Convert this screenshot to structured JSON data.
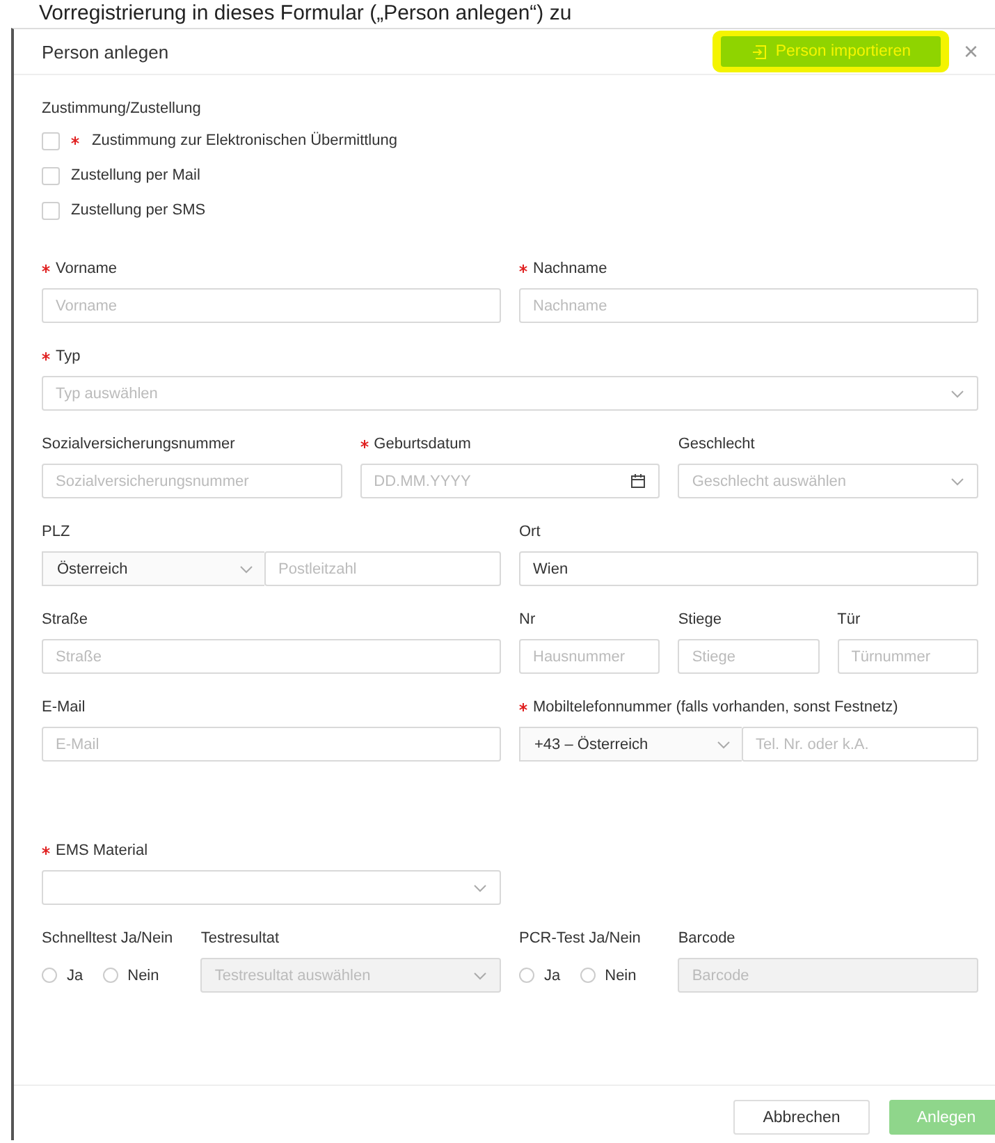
{
  "background_text": "Vorregistrierung in dieses Formular („Person anlegen“) zu",
  "dialog": {
    "title": "Person anlegen",
    "import_button": "Person importieren",
    "import_highlighted": true,
    "close": "×"
  },
  "consent": {
    "heading": "Zustimmung/Zustellung",
    "items": [
      {
        "label": "Zustimmung zur Elektronischen Übermittlung",
        "required": true,
        "checked": false
      },
      {
        "label": "Zustellung per Mail",
        "required": false,
        "checked": false
      },
      {
        "label": "Zustellung per SMS",
        "required": false,
        "checked": false
      }
    ]
  },
  "person_rows": [
    {
      "kind": "halves",
      "fields": [
        {
          "kind": "text",
          "label": "Vorname",
          "required": true,
          "placeholder": "Vorname"
        },
        {
          "kind": "text",
          "label": "Nachname",
          "required": true,
          "placeholder": "Nachname"
        }
      ]
    },
    {
      "kind": "full",
      "fields": [
        {
          "kind": "select",
          "label": "Typ",
          "required": true,
          "placeholder": "Typ auswählen",
          "disabled": false
        }
      ]
    },
    {
      "kind": "thirds",
      "fields": [
        {
          "kind": "text",
          "label": "Sozialversicherungsnummer",
          "required": false,
          "placeholder": "Sozialversicherungsnummer"
        },
        {
          "kind": "date",
          "label": "Geburtsdatum",
          "required": true,
          "placeholder": "DD.MM.YYYY"
        },
        {
          "kind": "select",
          "label": "Geschlecht",
          "required": false,
          "placeholder": "Geschlecht auswählen",
          "disabled": false
        }
      ]
    },
    {
      "kind": "halves",
      "fields": [
        {
          "kind": "prefixed",
          "label": "PLZ",
          "required": false,
          "prefix": "Österreich",
          "placeholder": "Postleitzahl"
        },
        {
          "kind": "text",
          "label": "Ort",
          "required": false,
          "value": "Wien"
        }
      ]
    },
    {
      "kind": "street",
      "fields": [
        {
          "kind": "text",
          "label": "Straße",
          "required": false,
          "placeholder": "Straße"
        },
        {
          "kind": "text",
          "label": "Nr",
          "required": false,
          "placeholder": "Hausnummer"
        },
        {
          "kind": "text",
          "label": "Stiege",
          "required": false,
          "placeholder": "Stiege"
        },
        {
          "kind": "text",
          "label": "Tür",
          "required": false,
          "placeholder": "Türnummer"
        }
      ]
    },
    {
      "kind": "halves",
      "fields": [
        {
          "kind": "text",
          "label": "E-Mail",
          "required": false,
          "placeholder": "E-Mail"
        },
        {
          "kind": "prefixed",
          "label": "Mobiltelefonnummer (falls vorhanden, sonst Festnetz)",
          "required": true,
          "prefix": "+43 – Österreich",
          "placeholder": "Tel. Nr. oder k.A."
        }
      ]
    }
  ],
  "test_rows": [
    {
      "kind": "half",
      "fields": [
        {
          "kind": "select",
          "label": "EMS Material",
          "required": true,
          "disabled": false
        }
      ]
    },
    {
      "kind": "tests",
      "fields": [
        {
          "kind": "radio",
          "label": "Schnelltest Ja/Nein",
          "required": false,
          "options": [
            {
              "label": "Ja",
              "selected": false
            },
            {
              "label": "Nein",
              "selected": false
            }
          ]
        },
        {
          "kind": "select",
          "label": "Testresultat",
          "required": false,
          "placeholder": "Testresultat auswählen",
          "disabled": true
        },
        {
          "kind": "radio",
          "label": "PCR-Test Ja/Nein",
          "required": false,
          "options": [
            {
              "label": "Ja",
              "selected": false
            },
            {
              "label": "Nein",
              "selected": false
            }
          ]
        },
        {
          "kind": "text",
          "label": "Barcode",
          "required": false,
          "placeholder": "Barcode",
          "disabled": true
        }
      ]
    }
  ],
  "footer": {
    "cancel": "Abbrechen",
    "submit": "Anlegen",
    "submit_disabled": true
  }
}
